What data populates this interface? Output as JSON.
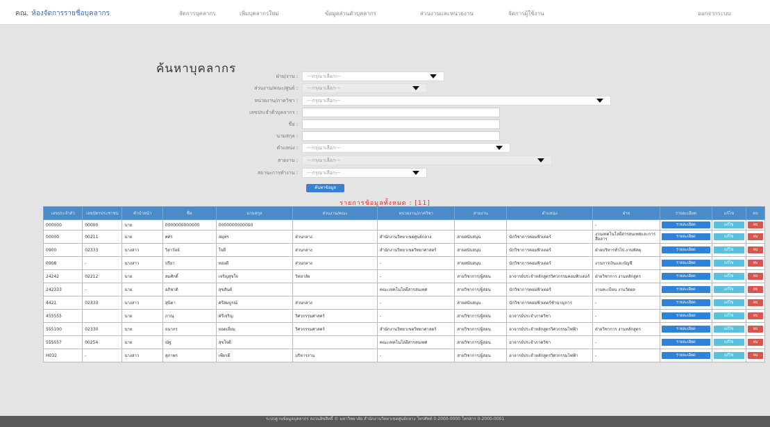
{
  "nav": {
    "brand_abbr": "คณ.",
    "brand": "ห้องจัดการรายชื่อบุคลากร",
    "links": [
      "จัดการบุคลากร",
      "เพิ่มบุคลากรใหม่",
      "ข้อมูลส่วนตัวบุคลากร",
      "ส่วนงานและหน่วยงาน",
      "จัดการผู้ใช้งาน"
    ],
    "logout": "ออกจากระบบ"
  },
  "page": {
    "title": "ค้นหาบุคลากร",
    "count_text": "รายการข้อมูลทั้งหมด : [11]"
  },
  "form": {
    "fields": [
      {
        "label": "ฝ่าย/งาน :",
        "value": "---กรุณาเลือก---"
      },
      {
        "label": "ส่วนงาน/คณะ/ศูนย์ :",
        "value": "---กรุณาเลือก---"
      },
      {
        "label": "หน่วยงาน/ภาควิชา :",
        "value": "---กรุณาเลือก---"
      },
      {
        "label": "เลขประจำตัวบุคลากร :",
        "value": ""
      },
      {
        "label": "ชื่อ :",
        "value": ""
      },
      {
        "label": "นามสกุล :",
        "value": ""
      },
      {
        "label": "ตำแหน่ง :",
        "value": "---กรุณาเลือก---"
      },
      {
        "label": "สายงาน :",
        "value": "---กรุณาเลือก---"
      },
      {
        "label": "สถานะการทำงาน :",
        "value": "---กรุณาเลือก---"
      }
    ],
    "search_label": "ค้นหาข้อมูล"
  },
  "table": {
    "headers": [
      "เลขประจำตัว",
      "เลขบัตรประชาชน",
      "คำนำหน้า",
      "ชื่อ",
      "นามสกุล",
      "ส่วนงาน/คณะ",
      "หน่วยงาน/ภาควิชา",
      "สายงาน",
      "ตำแหน่ง",
      "ฝ่าย",
      "รายละเอียด",
      "แก้ไข",
      "ลบ"
    ],
    "rows": [
      [
        "000000",
        "00000",
        "นาย",
        "0000000000000",
        "0000000000000",
        "",
        "",
        "",
        "",
        "-"
      ],
      [
        "00000",
        "00211",
        "นาย",
        "ศศร",
        "สมุทร",
        "ส่วนกลาง",
        "สำนักงานวิทยาเขตศูนย์กลาง",
        "สายสนับสนุน",
        "นักวิชาการคอมพิวเตอร์",
        "งานเทคโนโลยีสารสนเทศและการสื่อสาร"
      ],
      [
        "0900",
        "02333",
        "นางสาว",
        "วิลาวัลย์",
        "ใจดี",
        "ส่วนกลาง",
        "สำนักงานวิทยาเขตวิทยาศาสตร์",
        "สายสนับสนุน",
        "นักวิชาการคอมพิวเตอร์",
        "ฝ่ายบริหารทั่วไป งานพัสดุ"
      ],
      [
        "0908",
        "-",
        "นางสาว",
        "ปรียา",
        "ทองดี",
        "ส่วนกลาง",
        "-",
        "สายสนับสนุน",
        "นักวิชาการคอมพิวเตอร์",
        "งานการเงินและบัญชี"
      ],
      [
        "24242",
        "02212",
        "นาย",
        "สมศักดิ์",
        "เจริญสุขใจ",
        "วิทยาลัย",
        "-",
        "สายวิชาการ/ผู้สอน",
        "อาจารย์ประจำหลักสูตรวิศวกรรมคอมพิวเตอร์",
        "ฝ่ายวิชาการ งานหลักสูตร"
      ],
      [
        "242333",
        "-",
        "นาย",
        "อภิชาติ",
        "สุขสันต์",
        "",
        "คณะเทคโนโลยีสารสนเทศ",
        "สายวิชาการ/ผู้สอน",
        "นักวิชาการคอมพิวเตอร์",
        "งานทะเบียน งานวัดผล"
      ],
      [
        "4421",
        "02333",
        "นางสาว",
        "สุนิตา",
        "ศรีสมบูรณ์",
        "ส่วนกลาง",
        "-",
        "สายสนับสนุน",
        "นักวิชาการคอมพิวเตอร์ชำนาญการ",
        "-"
      ],
      [
        "455555",
        "",
        "นาย",
        "ภาณุ",
        "ศรีเจริญ",
        "วิศวกรรมศาสตร์",
        "-",
        "สายวิชาการ/ผู้สอน",
        "อาจารย์ประจำภาควิชา",
        "-"
      ],
      [
        "555100",
        "02330",
        "นาย",
        "ธนากร",
        "ยอดเยี่ยม",
        "วิศวกรรมศาสตร์",
        "สำนักงานวิทยาเขตวิทยาศาสตร์",
        "สายวิชาการ/ผู้สอน",
        "อาจารย์ประจำหลักสูตรวิศวกรรมไฟฟ้า",
        "ฝ่ายวิชาการ งานหลักสูตร"
      ],
      [
        "555557",
        "00254",
        "นาย",
        "ณัฐ",
        "สุขใจดี",
        "",
        "คณะเทคโนโลยีสารสนเทศ",
        "สายวิชาการ/ผู้สอน",
        "อาจารย์ประจำภาควิชา",
        "-"
      ],
      [
        "H032",
        "-",
        "นางสาว",
        "สุภาพร",
        "เพียรดี",
        "บริหารงาน",
        "-",
        "สายวิชาการ/ผู้สอน",
        "อาจารย์ประจำหลักสูตรวิศวกรรมไฟฟ้า",
        "-"
      ]
    ],
    "detail_label": "รายละเอียด",
    "edit_label": "แก้ไข",
    "delete_label": "ลบ"
  },
  "footer": {
    "text": "ระบบฐานข้อมูลบุคลากร สงวนลิขสิทธิ์ © มหาวิทยาลัย สำนักงานวิทยาเขตศูนย์กลาง โทรศัพท์ 0-2000-0000 โทรสาร 0-2000-0001"
  }
}
